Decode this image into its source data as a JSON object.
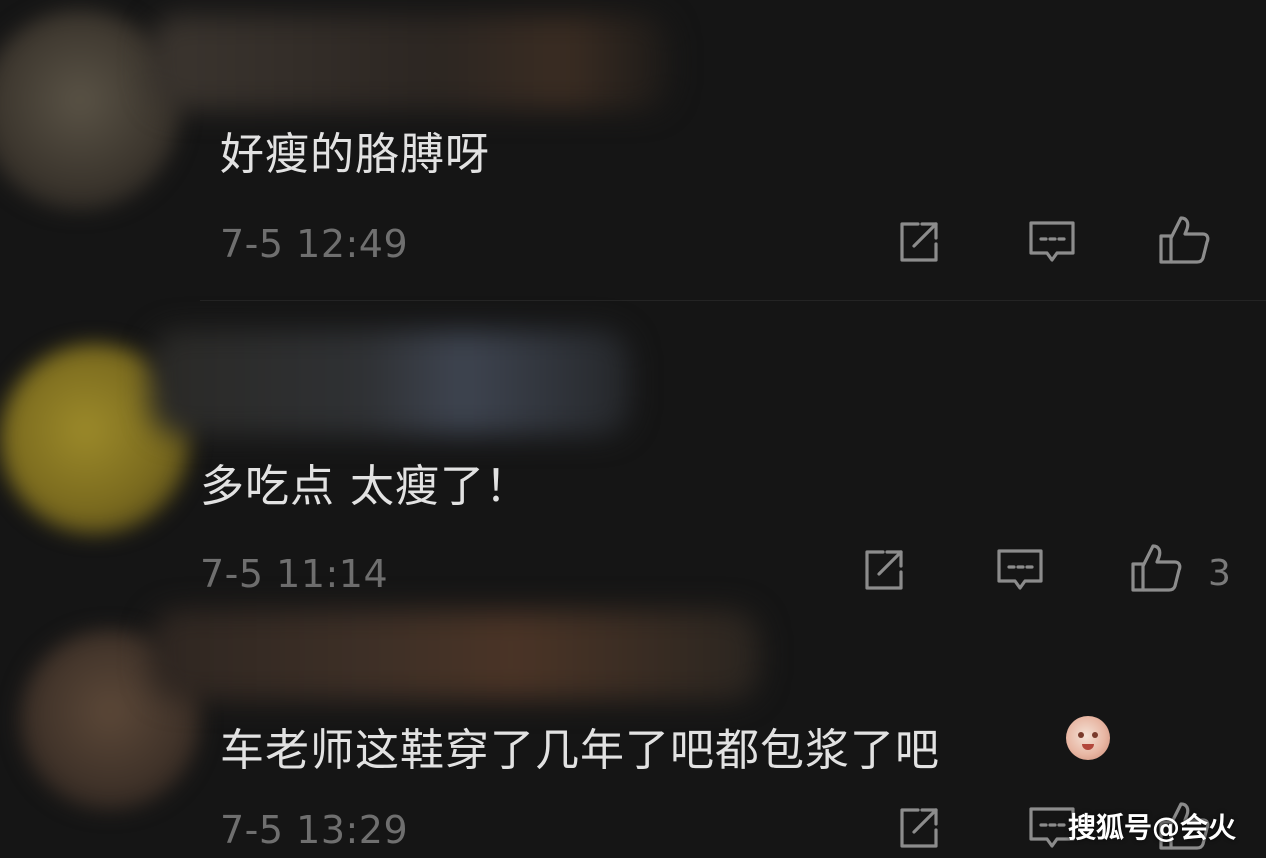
{
  "comments": [
    {
      "text": "好瘦的胳膊呀",
      "time": "7-5 12:49",
      "like_count": ""
    },
    {
      "text": "多吃点 太瘦了！",
      "time": "7-5 11:14",
      "like_count": "3"
    },
    {
      "text": "车老师这鞋穿了几年了吧都包浆了吧",
      "time": "7-5 13:29",
      "like_count": ""
    }
  ],
  "icons": {
    "share": "share-icon",
    "reply": "comment-icon",
    "like": "thumbs-up-icon"
  },
  "colors": {
    "background": "#151515",
    "text": "#e2e2e2",
    "meta": "#6f6f6f"
  },
  "watermark": "搜狐号@会火"
}
